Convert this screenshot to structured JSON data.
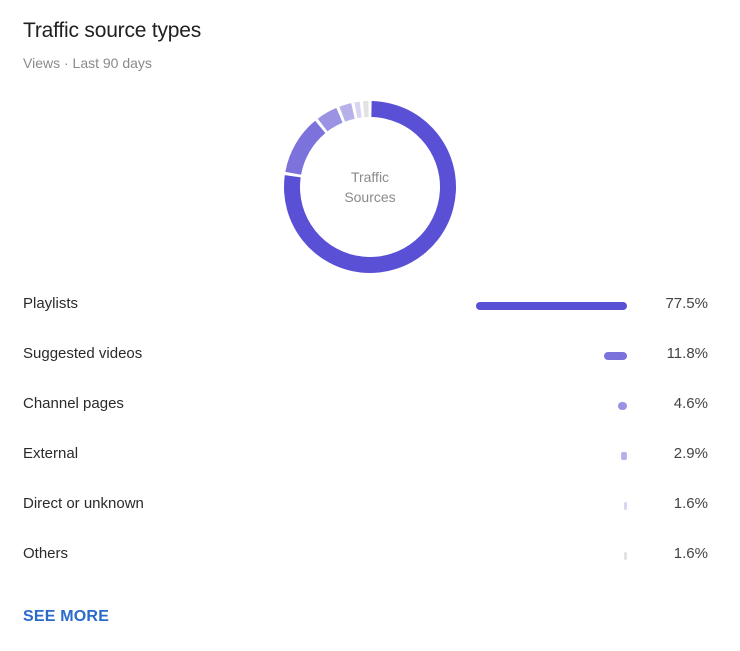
{
  "header": {
    "title": "Traffic source types",
    "subtitle": "Views · Last 90 days"
  },
  "donut": {
    "center_line1": "Traffic",
    "center_line2": "Sources"
  },
  "see_more_label": "SEE MORE",
  "chart_data": {
    "type": "pie",
    "variant": "donut",
    "title": "Traffic source types",
    "subtitle": "Views · Last 90 days",
    "center_text": "Traffic Sources",
    "categories": [
      "Playlists",
      "Suggested videos",
      "Channel pages",
      "External",
      "Direct or unknown",
      "Others"
    ],
    "values": [
      77.5,
      11.8,
      4.6,
      2.9,
      1.6,
      1.6
    ],
    "value_labels": [
      "77.5%",
      "11.8%",
      "4.6%",
      "2.9%",
      "1.6%",
      "1.6%"
    ],
    "unit": "%",
    "colors": [
      "#5a50d6",
      "#7b72dc",
      "#9a92e3",
      "#b7b1ea",
      "#d8d5f2",
      "#e2e2e4"
    ]
  }
}
